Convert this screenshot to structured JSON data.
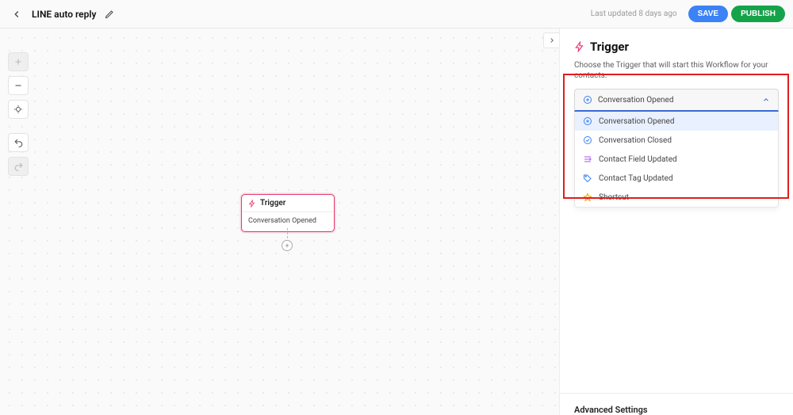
{
  "header": {
    "title": "LINE auto reply",
    "last_updated": "Last updated 8 days ago",
    "save_label": "SAVE",
    "publish_label": "PUBLISH"
  },
  "canvas": {
    "node": {
      "title": "Trigger",
      "value": "Conversation Opened"
    }
  },
  "panel": {
    "title": "Trigger",
    "description": "Choose the Trigger that will start this Workflow for your contacts.",
    "selected": "Conversation Opened",
    "options": [
      {
        "icon": "plus-circle",
        "color": "c-blue",
        "label": "Conversation Opened"
      },
      {
        "icon": "check-circle",
        "color": "c-blue",
        "label": "Conversation Closed"
      },
      {
        "icon": "field",
        "color": "c-purple",
        "label": "Contact Field Updated"
      },
      {
        "icon": "tag",
        "color": "c-blue",
        "label": "Contact Tag Updated"
      },
      {
        "icon": "shortcut",
        "color": "c-orange",
        "label": "Shortcut"
      }
    ],
    "advanced_label": "Advanced Settings"
  }
}
